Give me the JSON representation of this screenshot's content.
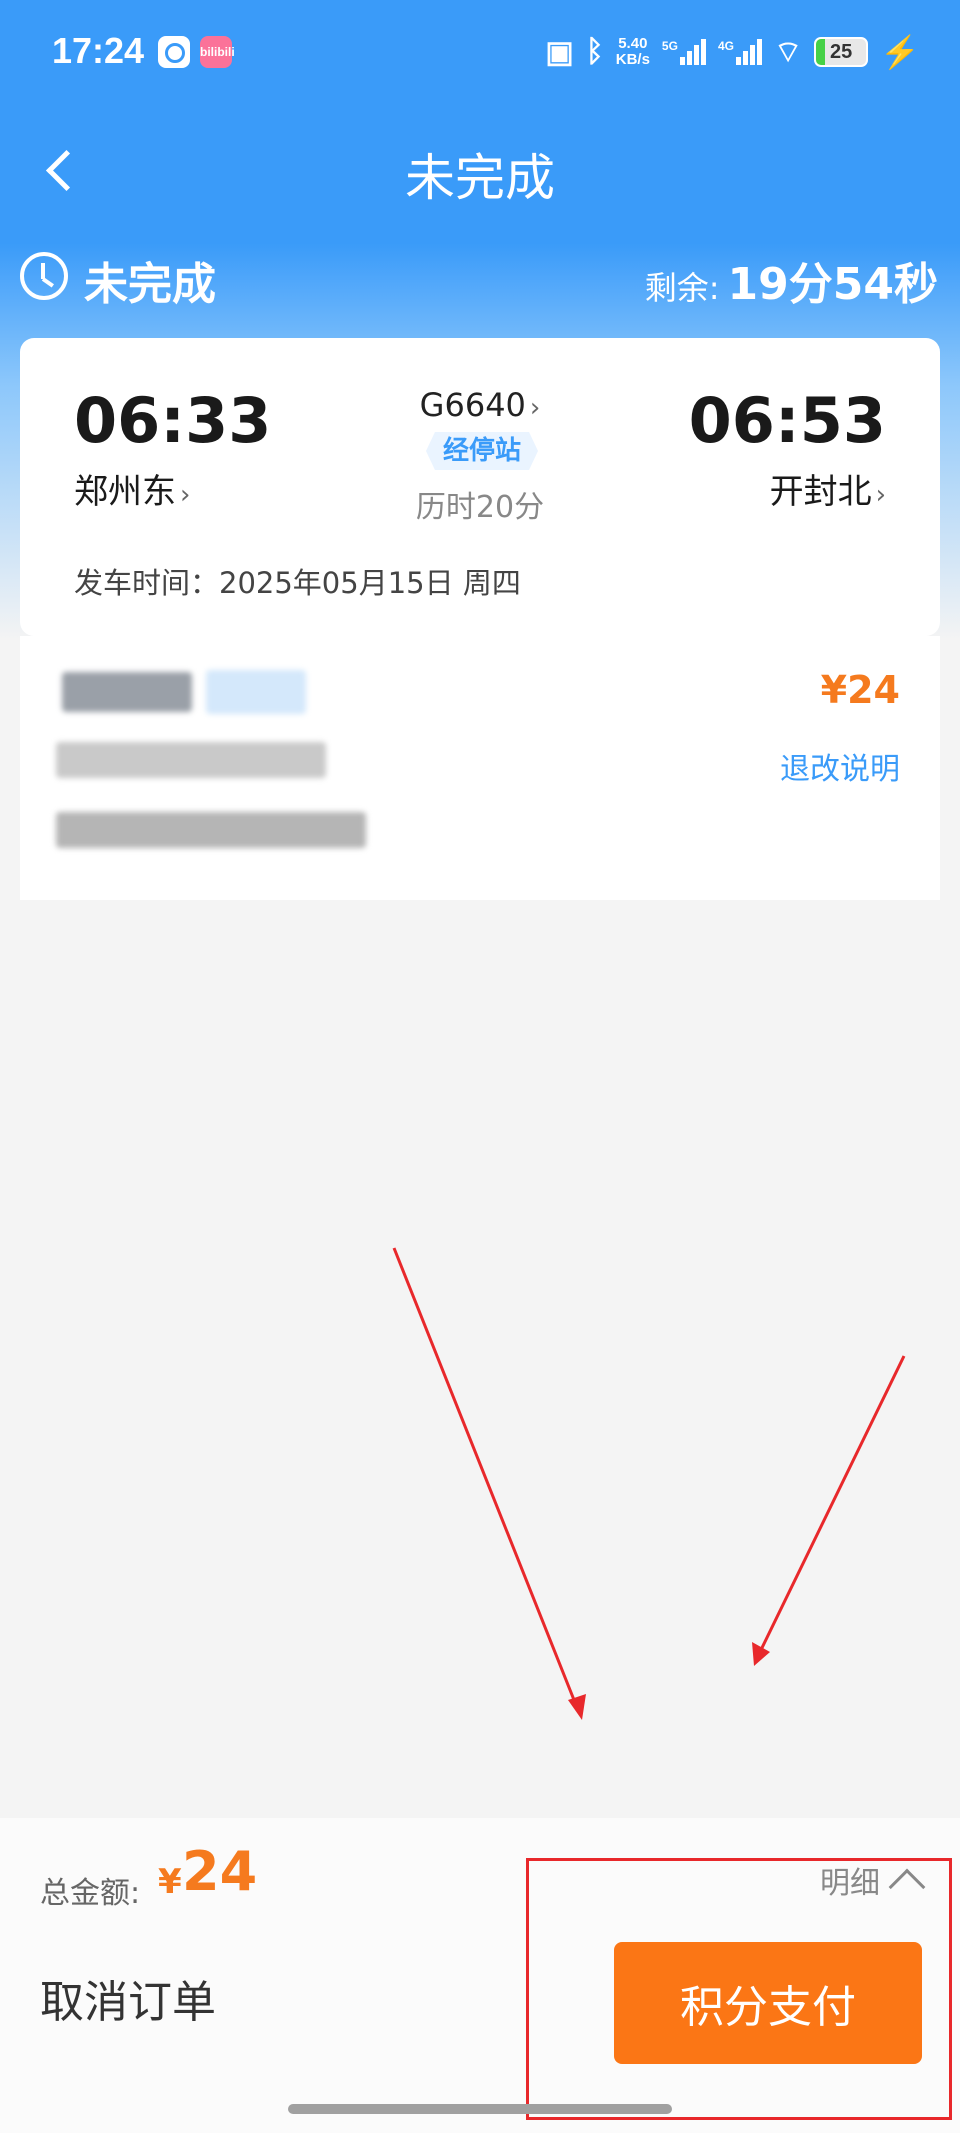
{
  "status_bar": {
    "time": "17:24",
    "app1_icon": "message-icon",
    "app2_label": "bilibili",
    "network_speed_value": "5.40",
    "network_speed_unit": "KB/s",
    "net1": "5G",
    "net2": "4G",
    "battery": "25"
  },
  "nav": {
    "title": "未完成"
  },
  "order_status": {
    "label": "未完成",
    "remain_label": "剩余:",
    "remain_value": "19分54秒"
  },
  "trip": {
    "departure_time": "06:33",
    "departure_station": "郑州东",
    "arrival_time": "06:53",
    "arrival_station": "开封北",
    "train_number": "G6640",
    "via_stations_label": "经停站",
    "duration": "历时20分",
    "departure_date": "发车时间：2025年05月15日 周四"
  },
  "passenger": {
    "price": "¥24",
    "refund_link": "退改说明"
  },
  "bottom": {
    "total_label": "总金额:",
    "total_currency": "¥",
    "total_value": "24",
    "detail_label": "明细",
    "cancel_label": "取消订单",
    "pay_label": "积分支付"
  },
  "colors": {
    "brand_blue": "#3a9bf9",
    "price_orange": "#f57a1e",
    "pay_button": "#fb7615",
    "annotation_red": "#e8282b"
  }
}
